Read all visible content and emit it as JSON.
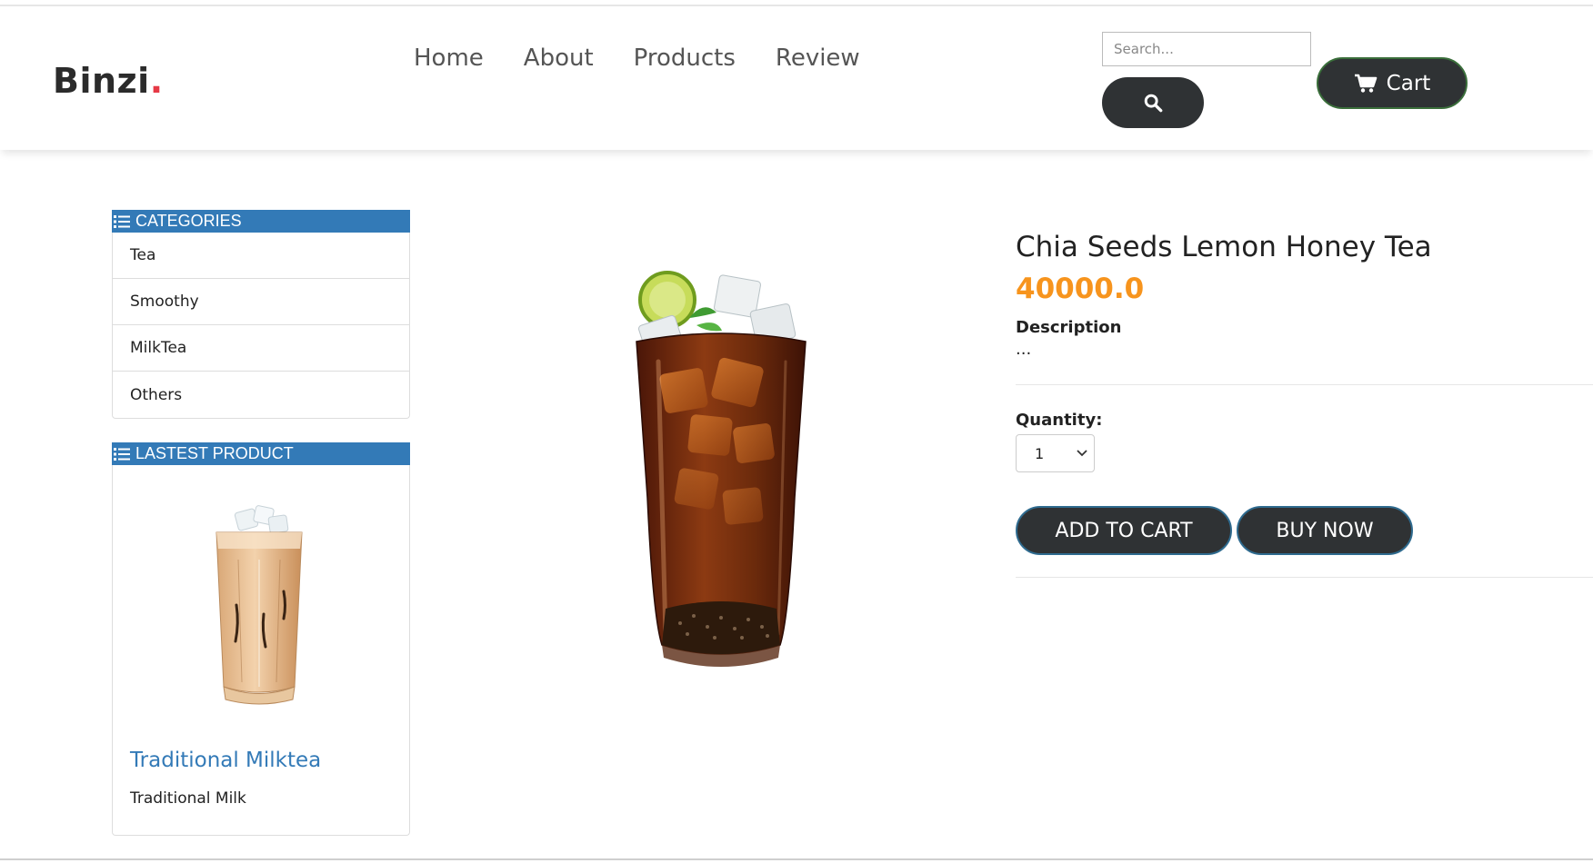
{
  "header": {
    "logo_text": "Binzi",
    "logo_dot": ".",
    "nav": [
      "Home",
      "About",
      "Products",
      "Review"
    ],
    "search_placeholder": "Search...",
    "cart_label": "Cart"
  },
  "sidebar": {
    "categories_title": "CATEGORIES",
    "categories": [
      "Tea",
      "Smoothy",
      "MilkTea",
      "Others"
    ],
    "latest_title": "LASTEST PRODUCT",
    "latest_product": {
      "name": "Traditional Milktea",
      "description": "Traditional Milk"
    }
  },
  "product": {
    "name": "Chia Seeds Lemon Honey Tea",
    "price": "40000.0",
    "description_label": "Description",
    "description": "...",
    "quantity_label": "Quantity:",
    "quantity_value": "1",
    "add_to_cart_label": "ADD TO CART",
    "buy_now_label": "BUY NOW"
  },
  "colors": {
    "accent_blue": "#337ab7",
    "price_orange": "#f7941d",
    "button_dark": "#2f3234",
    "logo_dot_red": "#e63946"
  }
}
